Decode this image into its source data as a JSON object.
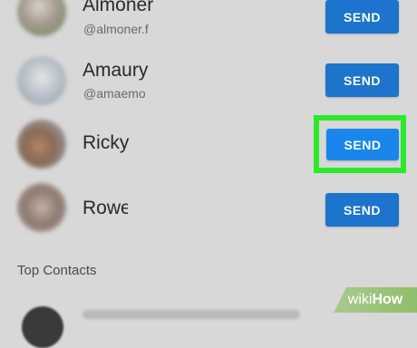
{
  "contacts": [
    {
      "name": "Almoner",
      "handle": "@almoner.f",
      "send_label": "SEND",
      "avatar_icon": "user-avatar-icon"
    },
    {
      "name": "Amaury",
      "handle": "@amaemo",
      "send_label": "SEND",
      "avatar_icon": "user-avatar-icon"
    },
    {
      "name": "Ricky",
      "handle": "",
      "send_label": "SEND",
      "avatar_icon": "user-avatar-icon"
    },
    {
      "name": "Rowe",
      "handle": "",
      "send_label": "SEND",
      "avatar_icon": "user-avatar-icon"
    }
  ],
  "top_contacts": {
    "header": "Top Contacts"
  },
  "watermark": {
    "prefix": "wiki",
    "suffix": "How"
  },
  "colors": {
    "send_button": "#1c74cc",
    "send_button_active": "#1a86ec",
    "highlight": "#2ee82e",
    "background": "#d8d8d8"
  }
}
